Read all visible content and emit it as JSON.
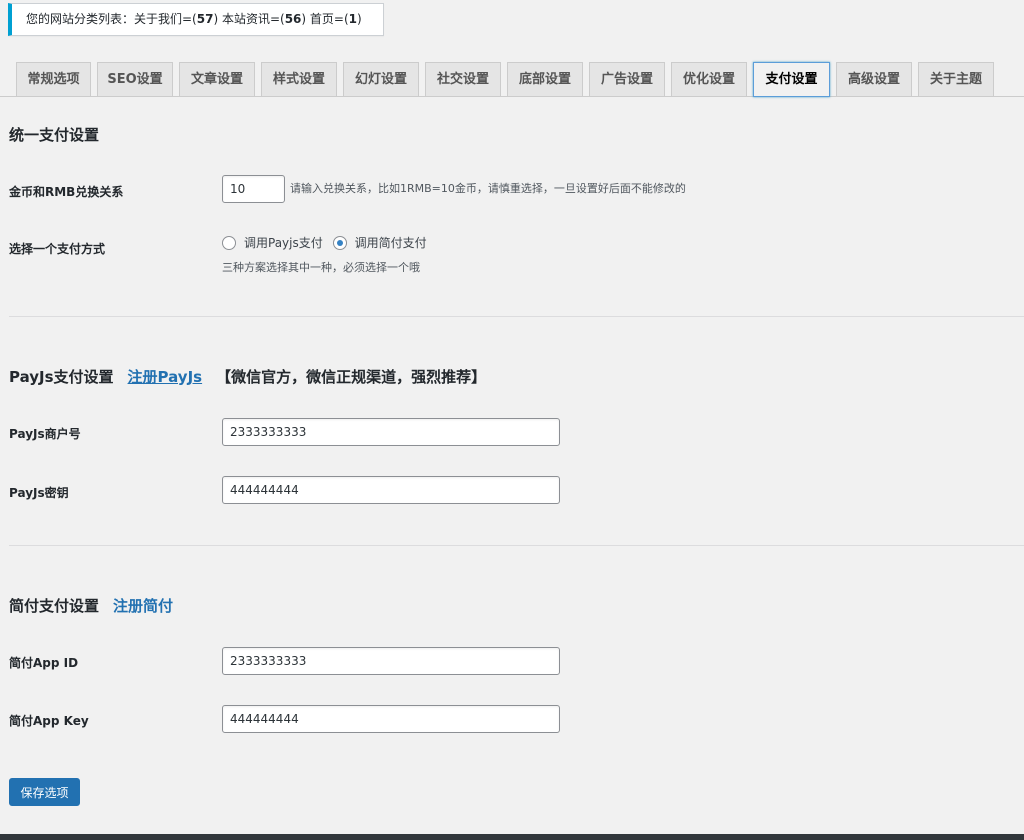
{
  "notice": {
    "prefix": "您的网站分类列表：关于我们=(",
    "count_about": "57",
    "mid1": ")  本站资讯=(",
    "count_news": "56",
    "mid2": ")  首页=(",
    "count_home": "1",
    "suffix": ")"
  },
  "tabs": [
    {
      "label": "常规选项"
    },
    {
      "label": "SEO设置"
    },
    {
      "label": "文章设置"
    },
    {
      "label": "样式设置"
    },
    {
      "label": "幻灯设置"
    },
    {
      "label": "社交设置"
    },
    {
      "label": "底部设置"
    },
    {
      "label": "广告设置"
    },
    {
      "label": "优化设置"
    },
    {
      "label": "支付设置"
    },
    {
      "label": "高级设置"
    },
    {
      "label": "关于主题"
    }
  ],
  "active_tab": "支付设置",
  "unified": {
    "title": "统一支付设置",
    "rate_label": "金币和RMB兑换关系",
    "rate_value": "10",
    "rate_hint": "请输入兑换关系，比如1RMB=10金币，请慎重选择，一旦设置好后面不能修改的",
    "method_label": "选择一个支付方式",
    "option_payjs": "调用Payjs支付",
    "option_jianfu": "调用简付支付",
    "selected_option": "调用简付支付",
    "method_hint": "三种方案选择其中一种，必须选择一个哦"
  },
  "payjs": {
    "title": "PayJs支付设置",
    "register_link": "注册PayJs",
    "note": "【微信官方，微信正规渠道，强烈推荐】",
    "merchant_label": "PayJs商户号",
    "merchant_value": "2333333333",
    "key_label": "PayJs密钥",
    "key_value": "444444444"
  },
  "jianfu": {
    "title": "简付支付设置",
    "register_link": "注册简付",
    "appid_label": "简付App ID",
    "appid_value": "2333333333",
    "appkey_label": "简付App Key",
    "appkey_value": "444444444"
  },
  "save_label": "保存选项",
  "colors": {
    "accent": "#2271b1",
    "notice_border": "#00a0d2",
    "active_tab_border": "#5b9dd9"
  }
}
